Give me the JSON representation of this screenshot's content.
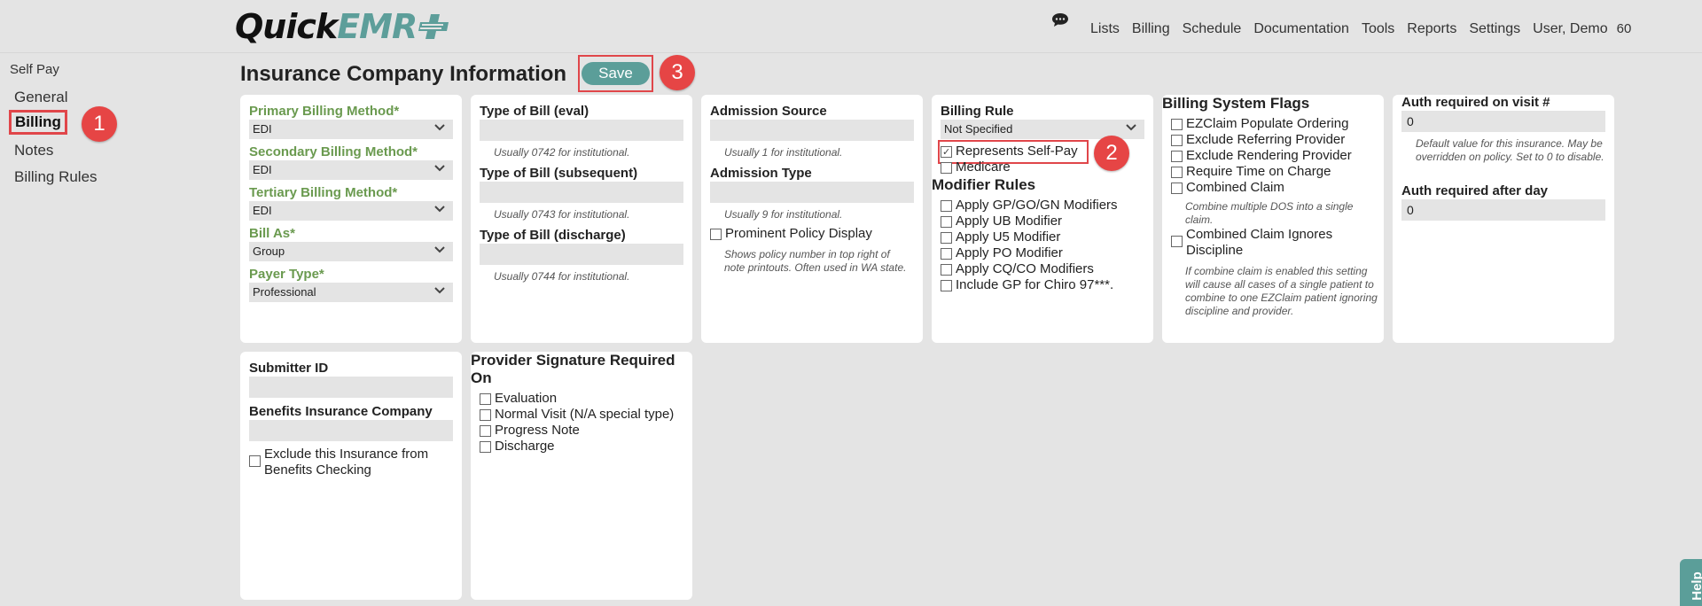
{
  "header": {
    "logo_quick": "Quick",
    "logo_emr": "EMR",
    "nav": [
      "Lists",
      "Billing",
      "Schedule",
      "Documentation",
      "Tools",
      "Reports",
      "Settings",
      "User, Demo"
    ],
    "count": "60"
  },
  "sidebar": {
    "section": "Self Pay",
    "items": [
      {
        "label": "General"
      },
      {
        "label": "Billing"
      },
      {
        "label": "Notes"
      },
      {
        "label": "Billing Rules"
      }
    ]
  },
  "page": {
    "title": "Insurance Company Information",
    "save_label": "Save"
  },
  "badges": [
    "1",
    "2",
    "3"
  ],
  "billing_methods": {
    "primary_label": "Primary Billing Method*",
    "primary_value": "EDI",
    "secondary_label": "Secondary Billing Method*",
    "secondary_value": "EDI",
    "tertiary_label": "Tertiary Billing Method*",
    "tertiary_value": "EDI",
    "bill_as_label": "Bill As*",
    "bill_as_value": "Group",
    "payer_type_label": "Payer Type*",
    "payer_type_value": "Professional"
  },
  "type_of_bill": {
    "eval_label": "Type of Bill (eval)",
    "eval_hint": "Usually 0742 for institutional.",
    "subsequent_label": "Type of Bill (subsequent)",
    "subsequent_hint": "Usually 0743 for institutional.",
    "discharge_label": "Type of Bill (discharge)",
    "discharge_hint": "Usually 0744 for institutional."
  },
  "admission": {
    "source_label": "Admission Source",
    "source_hint": "Usually 1 for institutional.",
    "type_label": "Admission Type",
    "type_hint": "Usually 9 for institutional.",
    "prominent_label": "Prominent Policy Display",
    "prominent_hint": "Shows policy number in top right of note printouts. Often used in WA state."
  },
  "billing_rule": {
    "label": "Billing Rule",
    "value": "Not Specified",
    "self_pay_label": "Represents Self-Pay",
    "self_pay_checked": true,
    "medicare_label": "Medicare",
    "modifier_title": "Modifier Rules",
    "modifiers": [
      "Apply GP/GO/GN Modifiers",
      "Apply UB Modifier",
      "Apply U5 Modifier",
      "Apply PO Modifier",
      "Apply CQ/CO Modifiers",
      "Include GP for Chiro 97***."
    ]
  },
  "system_flags": {
    "title": "Billing System Flags",
    "flags": [
      "EZClaim Populate Ordering",
      "Exclude Referring Provider",
      "Exclude Rendering Provider",
      "Require Time on Charge",
      "Combined Claim"
    ],
    "combined_hint": "Combine multiple DOS into a single claim.",
    "ignores_label": "Combined Claim Ignores Discipline",
    "ignores_hint": "If combine claim is enabled this setting will cause all cases of a single patient to combine to one EZClaim patient ignoring discipline and provider."
  },
  "auth": {
    "visit_label": "Auth required on visit #",
    "visit_value": "0",
    "visit_hint": "Default value for this insurance. May be overridden on policy. Set to 0 to disable.",
    "day_label": "Auth required after day",
    "day_value": "0"
  },
  "submitter": {
    "id_label": "Submitter ID",
    "benefits_label": "Benefits Insurance Company",
    "exclude_label": "Exclude this Insurance from Benefits Checking"
  },
  "signature": {
    "title": "Provider Signature Required On",
    "options": [
      "Evaluation",
      "Normal Visit (N/A special type)",
      "Progress Note",
      "Discharge"
    ]
  },
  "help": "Help"
}
